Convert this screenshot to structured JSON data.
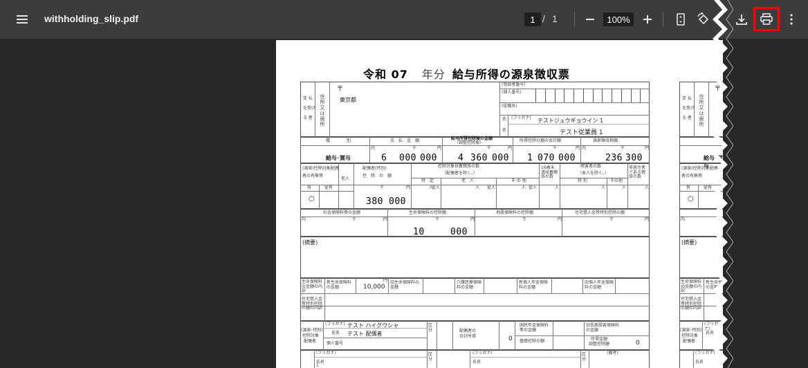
{
  "toolbar": {
    "file_name": "withholding_slip.pdf",
    "current_page": "1",
    "page_separator": "/",
    "total_pages": "1",
    "zoom": "100%"
  },
  "form": {
    "era": "令和 07",
    "year_label": "年分",
    "title": "給与所得の源泉徴収票",
    "recipient_label_1": "支 払",
    "recipient_label_2": "を受け",
    "recipient_label_3": "る 者",
    "address_label": "住所又は居所",
    "postal_mark": "〒",
    "address": "東京都",
    "recipient_no_label": "(受給者番号)",
    "individual_no_label": "(個人番号)",
    "position_label": "(役職名)",
    "furigana_label": "(フリガナ)",
    "name_furigana": "テストジュウギョウイン 1",
    "name_label_1": "氏",
    "name_label_2": "名",
    "name": "テスト従業員 1",
    "col_type": "種　　　　別",
    "col_payment": "支　払　金　額",
    "col_after_deduction_1": "給与所得控除後の金額",
    "col_after_deduction_2": "（調整控除後）",
    "col_total_deduction": "所得控除の額の合計額",
    "col_withholding": "源泉徴収税額",
    "unit_uchi": "内",
    "unit_sen": "千",
    "unit_yen": "円",
    "row_type": "給与･賞与",
    "payment_a": "6",
    "payment_b": "000",
    "payment_c": "000",
    "after_a": "4",
    "after_b": "360",
    "after_c": "000",
    "deduct_a": "1",
    "deduct_b": "070",
    "deduct_c": "000",
    "tax_a": "236",
    "tax_b": "300",
    "spouse_header_1": "(源泉)控除対象配偶",
    "spouse_header_2": "者の有無等",
    "elderly": "老人",
    "spouse_ded_1": "配偶者(特別)",
    "spouse_ded_2": "控　除　の　額",
    "dependents_1": "控除対象扶養親族の数",
    "dependents_2": "（配偶者を除く。）",
    "dep_specific": "特　定",
    "dep_elderly": "老　人",
    "dep_other": "そ の 他",
    "under16": "16歳未満扶養親族の数",
    "disabled_1": "障害者の数",
    "disabled_2": "（本人を除く。）",
    "dis_special": "特 別",
    "dis_other": "その他",
    "nonresident": "非居住者である親族の数",
    "has": "有",
    "subordinate": "従有",
    "unit_nin": "人",
    "dep_inner": "従人",
    "spouse_mark": "○",
    "spouse_amt_a": "380",
    "spouse_amt_b": "000",
    "social_ins": "社会保険料等の金額",
    "life_ins": "生命保険料の控除額",
    "quake_ins": "地震保険料の控除額",
    "housing_loan": "住宅借入金等特別控除の額",
    "life_a": "10",
    "life_b": "000",
    "remarks": "(摘要)",
    "life_detail_label": "生命保険料の金額の内訳",
    "new_life": "新生命保険料の金額",
    "new_life_amt": "10,000",
    "old_life": "旧生命保険料の金額",
    "care_ins": "介護医療保険料の金額",
    "new_pension": "新個人年金保険料の金額",
    "old_pension": "旧個人年金保険料の金額",
    "housing_detail": "住宅借入金等特別控除の額の内訳",
    "spouse_block_1": "(源泉･特別)",
    "spouse_block_2": "控除対象",
    "spouse_block_3": "配偶者",
    "spouse_furigana": "テスト ハイグウシャ",
    "spouse_name": "テスト 配偶者",
    "name_short": "氏名",
    "indiv_no_short": "個人番号",
    "kubun": "区分",
    "spouse_total_income_1": "配偶者の",
    "spouse_total_income_2": "合計所得",
    "spouse_total_income_val": "0",
    "national_pension": "国民年金保険料等の金額",
    "old_long_term": "旧長期損害保険料の金額",
    "basic_deduction": "基礎控除の額",
    "income_adjust_1": "所得金額",
    "income_adjust_2": "調整控除額",
    "income_adjust_val": "0",
    "remarks_short": "(備考)",
    "row_no": "1"
  }
}
